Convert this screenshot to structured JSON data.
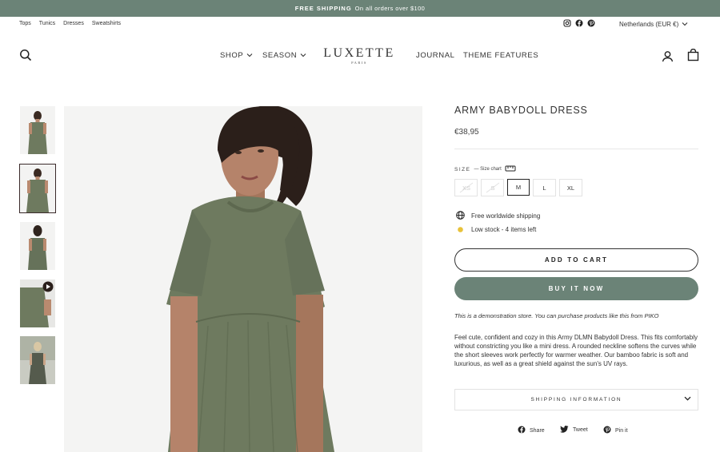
{
  "announcement": {
    "bold": "FREE SHIPPING",
    "text": "On all orders over $100"
  },
  "utility": {
    "links": [
      "Tops",
      "Tunics",
      "Dresses",
      "Sweatshirts"
    ],
    "social": [
      "instagram-icon",
      "facebook-icon",
      "pinterest-icon"
    ],
    "locale": "Netherlands (EUR €)"
  },
  "nav": {
    "shop": "SHOP",
    "season": "SEASON",
    "journal": "JOURNAL",
    "theme_features": "THEME FEATURES"
  },
  "logo": {
    "main": "LUXETTE",
    "sub": "PARIS"
  },
  "product": {
    "title": "ARMY BABYDOLL DRESS",
    "price": "€38,95",
    "size_label": "SIZE",
    "size_chart": "— Size chart",
    "sizes": [
      {
        "label": "XS",
        "state": "disabled"
      },
      {
        "label": "S",
        "state": "disabled"
      },
      {
        "label": "M",
        "state": "selected"
      },
      {
        "label": "L",
        "state": "available"
      },
      {
        "label": "XL",
        "state": "available"
      }
    ],
    "shipping_note": "Free worldwide shipping",
    "stock_note": "Low stock - 4 items left",
    "add_to_cart": "ADD TO CART",
    "buy_now": "BUY IT NOW",
    "demo_note": "This is a demonstration store. You can purchase products like this from PIKO",
    "description": "Feel cute, confident and cozy in this Army DLMN Babydoll Dress. This fits comfortably without constricting you like a mini dress. A rounded neckline softens the curves while the short sleeves work perfectly for warmer weather. Our bamboo fabric is soft and luxurious, as well as a great shield against the sun's UV rays.",
    "shipping_info": "SHIPPING INFORMATION"
  },
  "share": {
    "facebook": "Share",
    "twitter": "Tweet",
    "pinterest": "Pin it"
  },
  "colors": {
    "accent": "#6b8377",
    "dress": "#6e7a5f",
    "stock_dot": "#e8c23a"
  }
}
